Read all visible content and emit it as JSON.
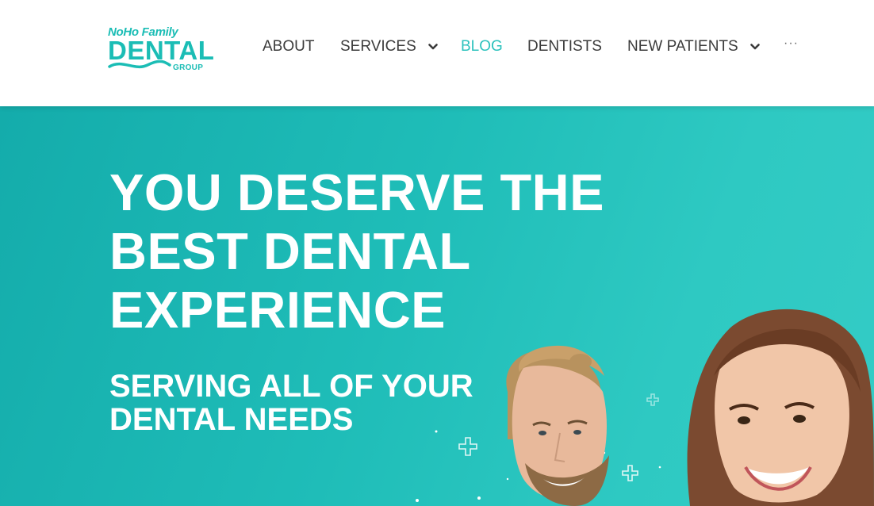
{
  "header": {
    "logo": {
      "line1": "NoHo Family",
      "line2": "DENTAL",
      "line3": "GROUP"
    },
    "nav": [
      {
        "label": "ABOUT",
        "has_dropdown": false,
        "active": false
      },
      {
        "label": "SERVICES",
        "has_dropdown": true,
        "active": false
      },
      {
        "label": "BLOG",
        "has_dropdown": false,
        "active": true
      },
      {
        "label": "DENTISTS",
        "has_dropdown": false,
        "active": false
      },
      {
        "label": "NEW PATIENTS",
        "has_dropdown": true,
        "active": false
      }
    ],
    "more_label": "···"
  },
  "hero": {
    "title_line1": "YOU DESERVE THE",
    "title_line2": "BEST DENTAL",
    "title_line3": "EXPERIENCE",
    "subtitle_line1": "SERVING ALL OF YOUR",
    "subtitle_line2": "DENTAL NEEDS"
  },
  "colors": {
    "brand_teal": "#1bbdb5",
    "nav_active": "#2cc2bd",
    "nav_text": "#3b3b3b",
    "hero_gradient_start": "#14acab",
    "hero_gradient_end": "#34ccc6"
  },
  "icons": [
    "chevron-down-icon",
    "plus-sparkle-icon",
    "more-icon"
  ]
}
